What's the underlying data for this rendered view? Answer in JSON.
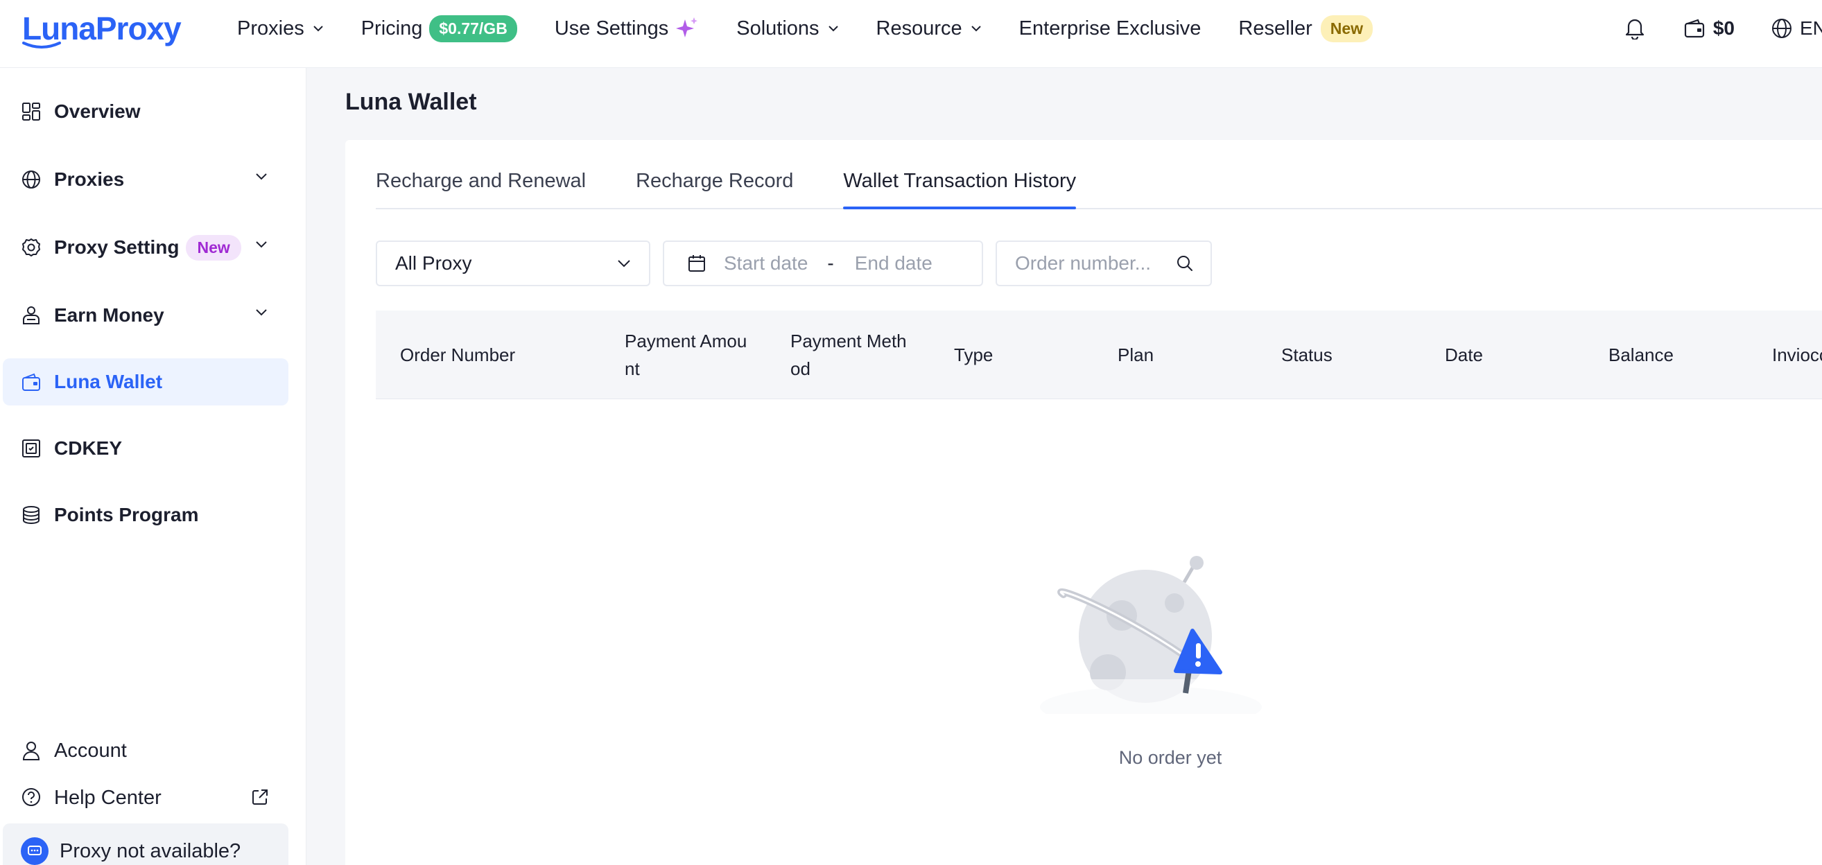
{
  "brand": {
    "logo_text": "LunaProxy"
  },
  "nav": {
    "items": [
      {
        "label": "Proxies"
      },
      {
        "label": "Pricing",
        "badge": "$0.77/GB"
      },
      {
        "label": "Use Settings"
      },
      {
        "label": "Solutions"
      },
      {
        "label": "Resource"
      },
      {
        "label": "Enterprise Exclusive"
      },
      {
        "label": "Reseller",
        "badge": "New"
      }
    ],
    "balance": "$0",
    "language": "EN"
  },
  "sidebar": {
    "items": [
      {
        "label": "Overview",
        "icon": "grid-icon"
      },
      {
        "label": "Proxies",
        "icon": "globe-icon"
      },
      {
        "label": "Proxy Setting",
        "icon": "gear-icon",
        "badge": "New"
      },
      {
        "label": "Earn Money",
        "icon": "earn-money-icon"
      },
      {
        "label": "Luna Wallet",
        "icon": "wallet-icon",
        "active": true
      },
      {
        "label": "CDKEY",
        "icon": "cdkey-icon"
      },
      {
        "label": "Points Program",
        "icon": "coins-icon"
      }
    ],
    "bottom": [
      {
        "label": "Account",
        "icon": "user-icon"
      },
      {
        "label": "Help Center",
        "icon": "help-icon"
      }
    ],
    "help_prompt": "Proxy not available?"
  },
  "page": {
    "title": "Luna Wallet",
    "tabs": [
      {
        "label": "Recharge and Renewal"
      },
      {
        "label": "Recharge Record"
      },
      {
        "label": "Wallet Transaction History",
        "active": true
      }
    ],
    "filters": {
      "proxy_select": "All Proxy",
      "start_placeholder": "Start date",
      "date_separator": "-",
      "end_placeholder": "End date",
      "order_placeholder": "Order number..."
    },
    "table": {
      "columns": [
        [
          "Order Number"
        ],
        [
          "Payment Amou",
          "nt"
        ],
        [
          "Payment Meth",
          "od"
        ],
        [
          "Type"
        ],
        [
          "Plan"
        ],
        [
          "Status"
        ],
        [
          "Date"
        ],
        [
          "Balance"
        ],
        [
          "Inviocc"
        ]
      ]
    },
    "empty_text": "No order yet"
  },
  "colors": {
    "accent": "#2b63f6",
    "pricing_badge": "#3fbf86",
    "new_badge": "#fdf0b8",
    "sidebar_new_badge": "#f3e4fb"
  }
}
